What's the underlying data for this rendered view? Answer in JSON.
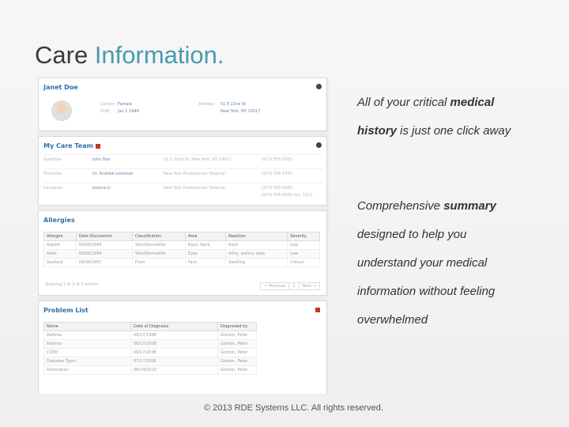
{
  "slide": {
    "title_part1": "Care ",
    "title_part2": "Information.",
    "blurb1_l1_a": "All of your critical ",
    "blurb1_l1_b": "medical",
    "blurb1_l2_a": "history",
    "blurb1_l2_b": " is just one click away",
    "blurb2_l1_a": "Comprehensive ",
    "blurb2_l1_b": "summary",
    "blurb2_l2": "designed to help you",
    "blurb2_l3": "understand your medical",
    "blurb2_l4": "information without feeling",
    "blurb2_l5": "overwhelmed",
    "footer": "© 2013 RDE Systems LLC. All rights reserved."
  },
  "colors": {
    "accent": "#4a9ab0",
    "link": "#2f6fa8",
    "flag": "#c0392b"
  },
  "profile": {
    "name": "Janet Doe",
    "gender_label": "Gender",
    "gender_value": "Female",
    "dob_label": "DOB",
    "dob_value": "Jan 1 1949",
    "address_label": "Address",
    "address_l1": "51 E 22nd St",
    "address_l2": "New York, NY 10017"
  },
  "care_team": {
    "title": "My Care Team",
    "rows": [
      {
        "role": "Guardian",
        "name": "John Doe",
        "place": "51 E 22nd St, New York, NY 10017",
        "phone": "(973) 555-5555"
      },
      {
        "role": "Physician",
        "name": "Dr. Andrew Lockman",
        "place": "New York Presbyterian Hospital",
        "phone": "(973) 555-5555"
      },
      {
        "role": "Caregiver",
        "name": "Jessica Li",
        "place": "New York Presbyterian Hospital",
        "phone": "(973) 555-5555"
      }
    ],
    "extra_phone": "(973) 555-5555 ext. 1111"
  },
  "allergies": {
    "title": "Allergies",
    "headers": [
      "Allergen",
      "Date Discovered",
      "Classification",
      "Area",
      "Reaction",
      "Severity"
    ],
    "rows": [
      [
        "Aspirin",
        "09/08/1994",
        "Skin/Dermatitis",
        "Back, Neck",
        "Rash",
        "Low"
      ],
      [
        "Aster",
        "09/08/1994",
        "Skin/Dermatitis",
        "Eyes",
        "Itchy, watery eyes",
        "Low"
      ],
      [
        "Seafood",
        "09/08/1997",
        "Food",
        "Face",
        "Swelling",
        "Critical"
      ]
    ],
    "showing": "Showing 1 to 3 of 3 entries",
    "pager_prev": "← Previous",
    "pager_page": "1",
    "pager_next": "Next →"
  },
  "problems": {
    "title": "Problem List",
    "headers": [
      "Name",
      "Date of Diagnosis",
      "Diagnosed by"
    ],
    "rows": [
      [
        "Asthma",
        "06/17/1998",
        "Gordon, Peter"
      ],
      [
        "Asthma",
        "06/17/2008",
        "Gordon, Peter"
      ],
      [
        "COPD",
        "06/17/2008",
        "Gordon, Peter"
      ],
      [
        "Diabetes Type I",
        "07/17/2006",
        "Gordon, Peter"
      ],
      [
        "Dislocation",
        "06/14/2010",
        "Gordon, Peter"
      ]
    ]
  }
}
